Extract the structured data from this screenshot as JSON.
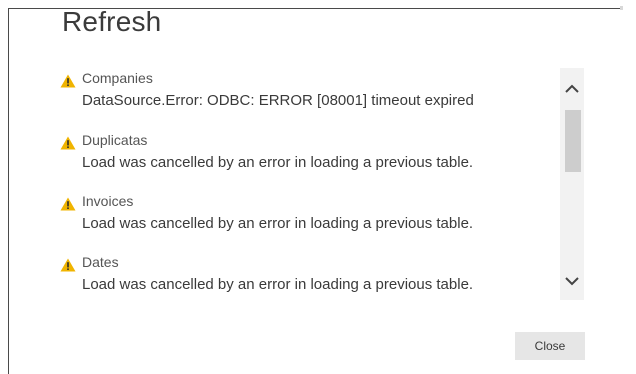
{
  "dialog": {
    "title": "Refresh",
    "close_label": "Close"
  },
  "items": [
    {
      "name": "Companies",
      "message": "DataSource.Error: ODBC: ERROR [08001] timeout expired",
      "icon": "warning-icon"
    },
    {
      "name": "Duplicatas",
      "message": "Load was cancelled by an error in loading a previous table.",
      "icon": "warning-icon"
    },
    {
      "name": "Invoices",
      "message": "Load was cancelled by an error in loading a previous table.",
      "icon": "warning-icon"
    },
    {
      "name": "Dates",
      "message": "Load was cancelled by an error in loading a previous table.",
      "icon": "warning-icon"
    }
  ],
  "colors": {
    "warning_fill": "#f0b400",
    "warning_mark": "#2b2b2b",
    "button_bg": "#e6e6e6",
    "scroll_thumb": "#cdcdcd"
  },
  "scrollbar": {
    "up_icon": "chevron-up-icon",
    "down_icon": "chevron-down-icon"
  }
}
